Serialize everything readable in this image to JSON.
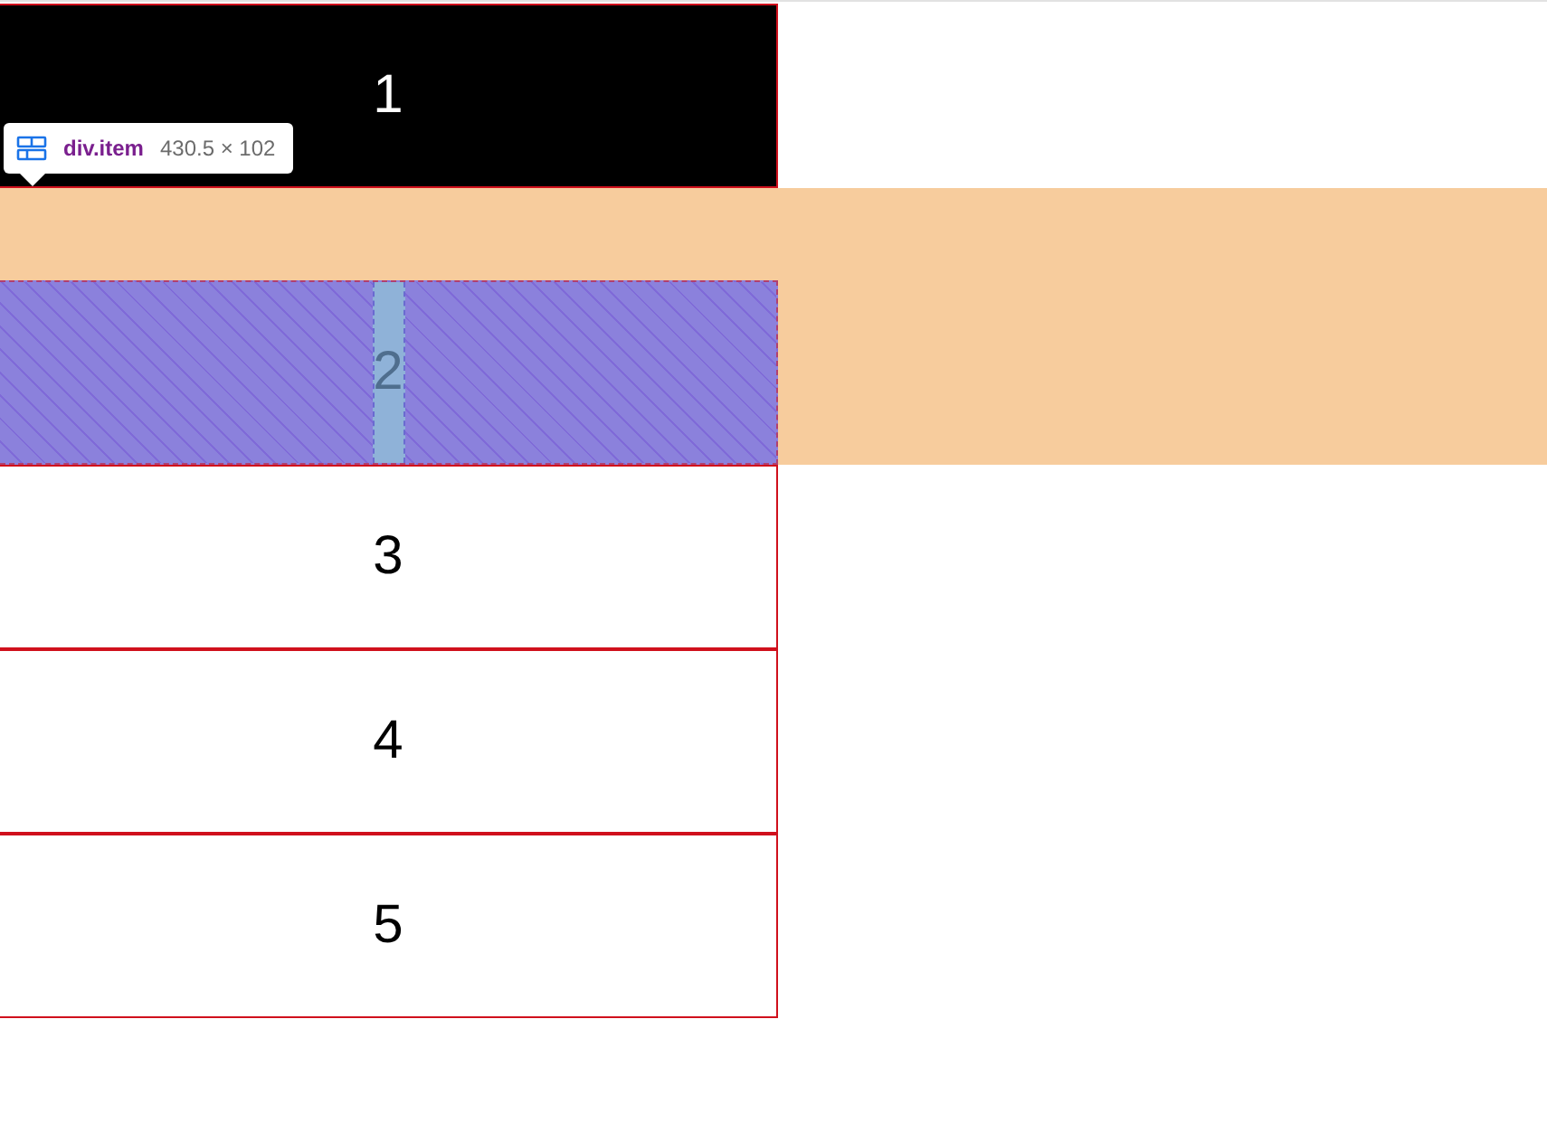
{
  "items": [
    {
      "label": "1",
      "kind": "dark"
    },
    {
      "label": "2",
      "kind": "inspected"
    },
    {
      "label": "3",
      "kind": "plain"
    },
    {
      "label": "4",
      "kind": "plain"
    },
    {
      "label": "5",
      "kind": "plain"
    }
  ],
  "tooltip": {
    "selector": "div.item",
    "size": "430.5 × 102"
  }
}
